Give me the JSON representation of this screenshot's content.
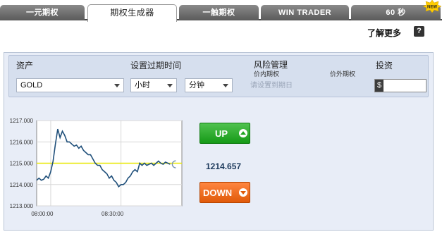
{
  "tabs": [
    {
      "label": "一元期权",
      "active": false
    },
    {
      "label": "期权生成器",
      "active": true
    },
    {
      "label": "一触期权",
      "active": false
    },
    {
      "label": "WIN TRADER",
      "active": false
    },
    {
      "label": "60 秒",
      "active": false
    }
  ],
  "new_badge": "NEW",
  "header": {
    "learn_more": "了解更多",
    "help": "?"
  },
  "controls": {
    "asset_label": "资产",
    "asset_value": "GOLD",
    "expiry_label": "设置过期时间",
    "expiry_unit_1": "小时",
    "expiry_unit_2": "分钟",
    "risk_label": "风险管理",
    "in_money_label": "价内期权",
    "out_money_label": "价外期权",
    "expiry_hint": "请设置到期日",
    "invest_label": "投资",
    "currency": "$",
    "invest_value": ""
  },
  "price": "1214.657",
  "buttons": {
    "up": "UP",
    "down": "DOWN"
  },
  "colors": {
    "up": "#169a17",
    "down": "#e05a0a",
    "line": "#1f4f7a",
    "strike": "#e8e800"
  },
  "chart_data": {
    "type": "line",
    "title": "",
    "xlabel": "",
    "ylabel": "",
    "x_ticks": [
      "08:00:00",
      "08:30:00"
    ],
    "y_ticks": [
      "1217.000",
      "1216.000",
      "1215.000",
      "1214.000",
      "1213.000"
    ],
    "ylim": [
      1213.0,
      1217.0
    ],
    "x_range_minutes": [
      -6,
      56
    ],
    "strike": 1215.0,
    "grid": true,
    "series": [
      {
        "points": [
          [
            -6,
            1214.2
          ],
          [
            -5,
            1214.3
          ],
          [
            -4,
            1214.2
          ],
          [
            -3,
            1214.25
          ],
          [
            -2,
            1214.4
          ],
          [
            -1,
            1214.3
          ],
          [
            0,
            1214.6
          ],
          [
            1,
            1215.1
          ],
          [
            2,
            1215.9
          ],
          [
            3,
            1216.6
          ],
          [
            4,
            1216.2
          ],
          [
            5,
            1216.5
          ],
          [
            6,
            1216.3
          ],
          [
            7,
            1216.0
          ],
          [
            8,
            1216.0
          ],
          [
            9,
            1215.9
          ],
          [
            10,
            1215.8
          ],
          [
            11,
            1215.85
          ],
          [
            12,
            1215.7
          ],
          [
            13,
            1215.8
          ],
          [
            14,
            1215.6
          ],
          [
            15,
            1215.5
          ],
          [
            16,
            1215.4
          ],
          [
            17,
            1215.4
          ],
          [
            18,
            1215.2
          ],
          [
            19,
            1215.0
          ],
          [
            20,
            1214.9
          ],
          [
            21,
            1214.9
          ],
          [
            22,
            1214.7
          ],
          [
            23,
            1214.6
          ],
          [
            24,
            1214.5
          ],
          [
            25,
            1214.3
          ],
          [
            26,
            1214.4
          ],
          [
            27,
            1214.2
          ],
          [
            28,
            1214.1
          ],
          [
            29,
            1213.9
          ],
          [
            30,
            1214.0
          ],
          [
            31,
            1214.0
          ],
          [
            32,
            1214.1
          ],
          [
            33,
            1214.3
          ],
          [
            34,
            1214.4
          ],
          [
            35,
            1214.6
          ],
          [
            36,
            1214.7
          ],
          [
            37,
            1214.6
          ],
          [
            38,
            1215.0
          ],
          [
            39,
            1214.9
          ],
          [
            40,
            1215.0
          ],
          [
            41,
            1214.9
          ],
          [
            42,
            1214.95
          ],
          [
            43,
            1215.0
          ],
          [
            44,
            1214.9
          ],
          [
            45,
            1215.0
          ],
          [
            46,
            1215.1
          ],
          [
            47,
            1215.0
          ],
          [
            48,
            1214.95
          ],
          [
            49,
            1215.05
          ],
          [
            50,
            1215.0
          ],
          [
            51,
            1214.95
          ]
        ]
      }
    ]
  }
}
